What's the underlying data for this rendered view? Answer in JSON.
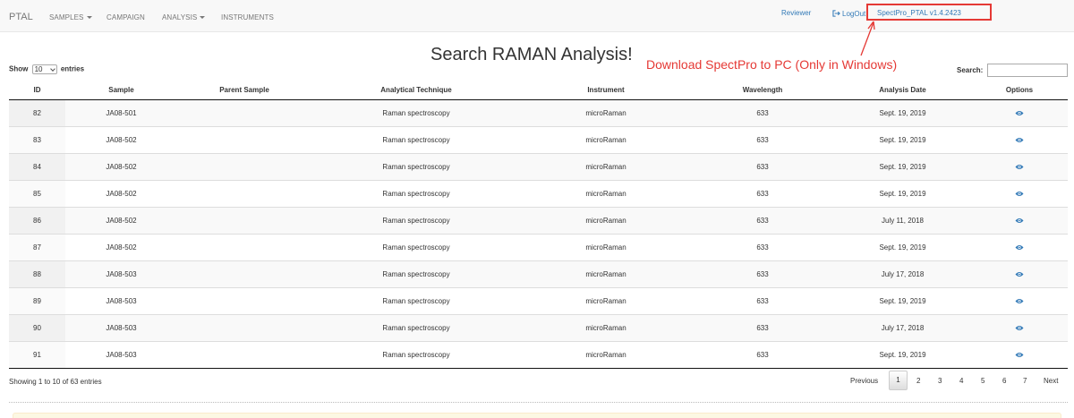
{
  "navbar": {
    "brand": "PTAL",
    "items": [
      "SAMPLES",
      "CAMPAIGN",
      "ANALYSIS",
      "INSTRUMENTS"
    ],
    "reviewer": "Reviewer",
    "logout": "LogOut",
    "spectpro_link": "SpectPro_PTAL v1.4.2423"
  },
  "annotation": {
    "text": "Download SpectPro to PC (Only in Windows)",
    "color": "#e53935"
  },
  "page": {
    "title": "Search RAMAN Analysis!",
    "show_label": "Show",
    "entries_label": "entries",
    "page_size": "10",
    "search_label": "Search:",
    "search_value": ""
  },
  "table": {
    "headers": [
      "ID",
      "Sample",
      "Parent Sample",
      "Analytical Technique",
      "Instrument",
      "Wavelength",
      "Analysis Date",
      "Options"
    ],
    "rows": [
      {
        "id": "82",
        "sample": "JA08-501",
        "parent": "",
        "technique": "Raman spectroscopy",
        "instrument": "microRaman",
        "wavelength": "633",
        "date": "Sept. 19, 2019"
      },
      {
        "id": "83",
        "sample": "JA08-502",
        "parent": "",
        "technique": "Raman spectroscopy",
        "instrument": "microRaman",
        "wavelength": "633",
        "date": "Sept. 19, 2019"
      },
      {
        "id": "84",
        "sample": "JA08-502",
        "parent": "",
        "technique": "Raman spectroscopy",
        "instrument": "microRaman",
        "wavelength": "633",
        "date": "Sept. 19, 2019"
      },
      {
        "id": "85",
        "sample": "JA08-502",
        "parent": "",
        "technique": "Raman spectroscopy",
        "instrument": "microRaman",
        "wavelength": "633",
        "date": "Sept. 19, 2019"
      },
      {
        "id": "86",
        "sample": "JA08-502",
        "parent": "",
        "technique": "Raman spectroscopy",
        "instrument": "microRaman",
        "wavelength": "633",
        "date": "July 11, 2018"
      },
      {
        "id": "87",
        "sample": "JA08-502",
        "parent": "",
        "technique": "Raman spectroscopy",
        "instrument": "microRaman",
        "wavelength": "633",
        "date": "Sept. 19, 2019"
      },
      {
        "id": "88",
        "sample": "JA08-503",
        "parent": "",
        "technique": "Raman spectroscopy",
        "instrument": "microRaman",
        "wavelength": "633",
        "date": "July 17, 2018"
      },
      {
        "id": "89",
        "sample": "JA08-503",
        "parent": "",
        "technique": "Raman spectroscopy",
        "instrument": "microRaman",
        "wavelength": "633",
        "date": "Sept. 19, 2019"
      },
      {
        "id": "90",
        "sample": "JA08-503",
        "parent": "",
        "technique": "Raman spectroscopy",
        "instrument": "microRaman",
        "wavelength": "633",
        "date": "July 17, 2018"
      },
      {
        "id": "91",
        "sample": "JA08-503",
        "parent": "",
        "technique": "Raman spectroscopy",
        "instrument": "microRaman",
        "wavelength": "633",
        "date": "Sept. 19, 2019"
      }
    ],
    "option_icon": "eye-icon"
  },
  "footer": {
    "info": "Showing 1 to 10 of 63 entries",
    "previous": "Previous",
    "pages": [
      "1",
      "2",
      "3",
      "4",
      "5",
      "6",
      "7"
    ],
    "active_page": "1",
    "next": "Next"
  },
  "colors": {
    "link": "#337ab7",
    "annotation": "#e53935",
    "navbar_bg": "#f8f8f8"
  }
}
